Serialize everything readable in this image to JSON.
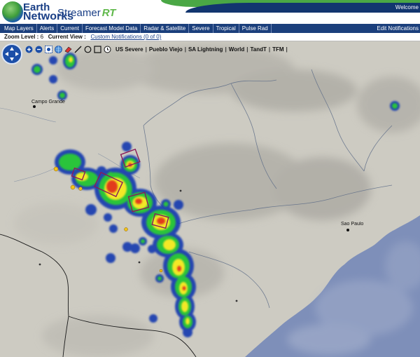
{
  "header": {
    "brand_line1": "Earth",
    "brand_line2": "Networks",
    "product": "Streamer",
    "product_suffix": "RT",
    "welcome": "Welcome"
  },
  "menu": {
    "items": [
      "Map Layers",
      "Alerts",
      "Current",
      "Forecast Model Data",
      "Radar & Satellite",
      "Severe",
      "Tropical",
      "Pulse Rad"
    ],
    "edit_label": "Edit Notifications"
  },
  "status": {
    "zoom_label": "Zoom Level :",
    "zoom_value": "6",
    "view_label": "Current View :",
    "view_link": "Custom Notifications (0 of 0)"
  },
  "toolbar": {
    "layers": [
      "US Severe",
      "Pueblo Viejo",
      "SA Lightning",
      "World",
      "TandT",
      "TFM"
    ],
    "separator": "|"
  },
  "map": {
    "cities": [
      "Campo Grande",
      "Sao Paulo"
    ],
    "colors": {
      "land": "#cdcbc2",
      "ocean": "#7e8fb9",
      "storm_blue": "#1a3fb0",
      "storm_green": "#2bc43a",
      "storm_yellow": "#f3e826",
      "storm_red": "#e23a1c",
      "warning_box": "#8a1a5a"
    }
  }
}
